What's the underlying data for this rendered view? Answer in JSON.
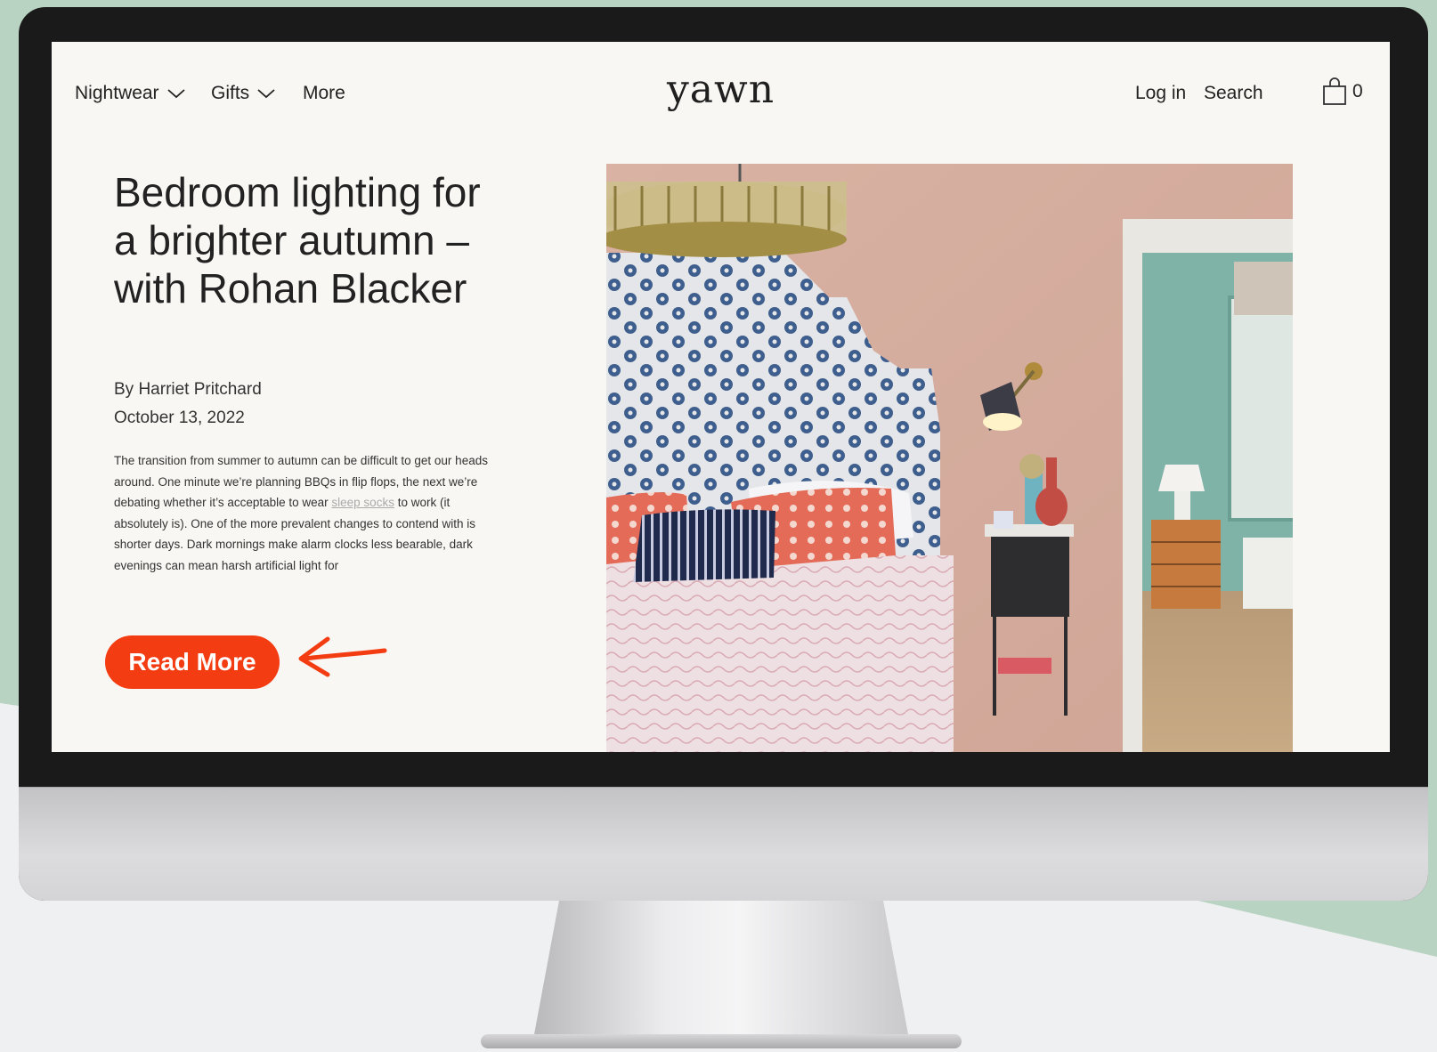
{
  "nav": {
    "left_items": [
      {
        "label": "Nightwear",
        "has_dropdown": true
      },
      {
        "label": "Gifts",
        "has_dropdown": true
      },
      {
        "label": "More",
        "has_dropdown": false
      }
    ],
    "logo": "yawn",
    "login_label": "Log in",
    "search_label": "Search",
    "cart_count": "0"
  },
  "article": {
    "title": "Bedroom lighting for a brighter autumn – with Rohan Blacker",
    "author": "By Harriet Pritchard",
    "date": "October 13, 2022",
    "excerpt_before_link": "The transition from summer to autumn can be difficult to get our heads around. One minute we’re planning BBQs in flip flops, the next we’re debating whether it’s acceptable to wear ",
    "excerpt_link": "sleep socks",
    "excerpt_after_link": " to work (it absolutely is). One of the more prevalent changes to contend with is shorter days. Dark mornings make alarm clocks less bearable, dark evenings can mean harsh artificial light for",
    "read_more_label": "Read More"
  },
  "colors": {
    "accent": "#f33c12",
    "page_bg": "#f8f7f3",
    "backdrop": "#b8d3c2"
  },
  "icons": {
    "dropdown": "chevron-down-icon",
    "cart": "shopping-bag-icon",
    "pointer": "arrow-left-icon"
  }
}
